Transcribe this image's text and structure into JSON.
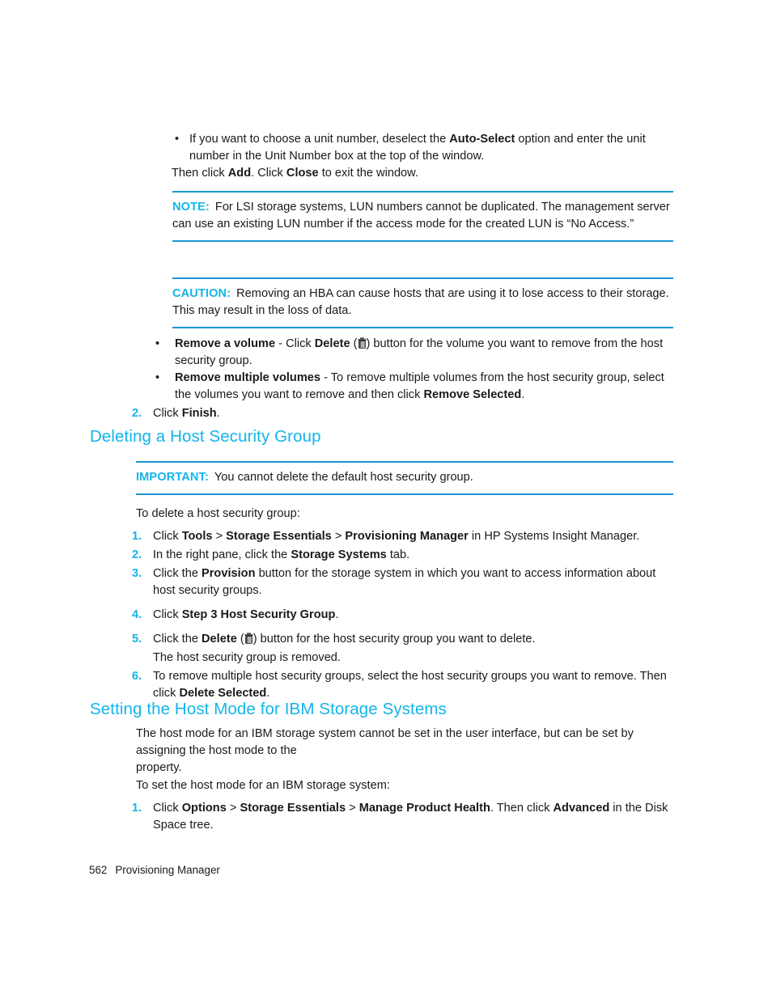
{
  "page": {
    "footer_page_number": "562",
    "footer_title": "Provisioning Manager",
    "accent_color": "#13b5ea",
    "rule_color": "#1a96d2",
    "text_color": "#1a1a1a"
  },
  "top_bullets": {
    "bullet_glyph": "•",
    "item1": {
      "pre": "If you want to choose a unit number, deselect the ",
      "bold1": "Auto-Select",
      "post": " option and enter the unit number in the Unit Number box at the top of the window."
    },
    "follow": {
      "pre": "Then click ",
      "bold1": "Add",
      "mid": ". Click ",
      "bold2": "Close",
      "post": " to exit the window."
    }
  },
  "note_box": {
    "label": "NOTE:",
    "text": "For LSI storage systems, LUN numbers cannot be duplicated. The management server can use an existing LUN number if the access mode for the created LUN is “No Access.”"
  },
  "caution_box": {
    "label": "CAUTION:",
    "text": "Removing an HBA can cause hosts that are using it to lose access to their storage. This may result in the loss of data."
  },
  "volume_bullets": {
    "bullet_glyph": "•",
    "item1": {
      "bold1": "Remove a volume",
      "mid1": " - Click ",
      "bold2": "Delete",
      "mid2": " (",
      "icon": "trash-icon",
      "post": ") button for the volume you want to remove from the host security group."
    },
    "item2": {
      "bold1": "Remove multiple volumes",
      "mid1": " - To remove multiple volumes from the host security group, select the volumes you want to remove and then click ",
      "bold2": "Remove Selected",
      "post": "."
    }
  },
  "finish_step": {
    "marker": "2.",
    "pre": "Click ",
    "bold1": "Finish",
    "post": "."
  },
  "heading_delete": "Deleting a Host Security Group",
  "important_box": {
    "label": "IMPORTANT:",
    "text": "You cannot delete the default host security group."
  },
  "intro_delete": "To delete a host security group:",
  "delete_steps": [
    {
      "marker": "1.",
      "pre": "Click ",
      "bold1": "Tools",
      "sep1": " > ",
      "bold2": "Storage Essentials",
      "sep2": " > ",
      "bold3": "Provisioning Manager",
      "post": " in HP Systems Insight Manager."
    },
    {
      "marker": "2.",
      "pre": "In the right pane, click the ",
      "bold1": "Storage Systems",
      "post": " tab."
    },
    {
      "marker": "3.",
      "pre": "Click the ",
      "bold1": "Provision",
      "post": " button for the storage system in which you want to access information about host security groups."
    },
    {
      "marker": "4.",
      "pre": "Click ",
      "bold1": "Step 3 Host Security Group",
      "post": "."
    },
    {
      "marker": "5.",
      "pre": "Click the ",
      "bold1": "Delete",
      "mid": " (",
      "icon": "trash-icon",
      "post": ") button for the host security group you want to delete.",
      "sub": "The host security group is removed."
    },
    {
      "marker": "6.",
      "pre": "To remove multiple host security groups, select the host security groups you want to remove. Then click ",
      "bold1": "Delete Selected",
      "post": "."
    }
  ],
  "heading_hostmode": "Setting the Host Mode for IBM Storage Systems",
  "hostmode_para_line1": "The host mode for an IBM storage system cannot be set in the user interface, but can be set by assigning the host mode to the",
  "hostmode_para_line2": "property.",
  "intro_hostmode": "To set the host mode for an IBM storage system:",
  "hostmode_steps": [
    {
      "marker": "1.",
      "pre": "Click ",
      "bold1": "Options",
      "sep1": " > ",
      "bold2": "Storage Essentials",
      "sep2": " > ",
      "bold3": "Manage Product Health",
      "mid": ". Then click ",
      "bold4": "Advanced",
      "post": " in the Disk Space tree."
    }
  ]
}
